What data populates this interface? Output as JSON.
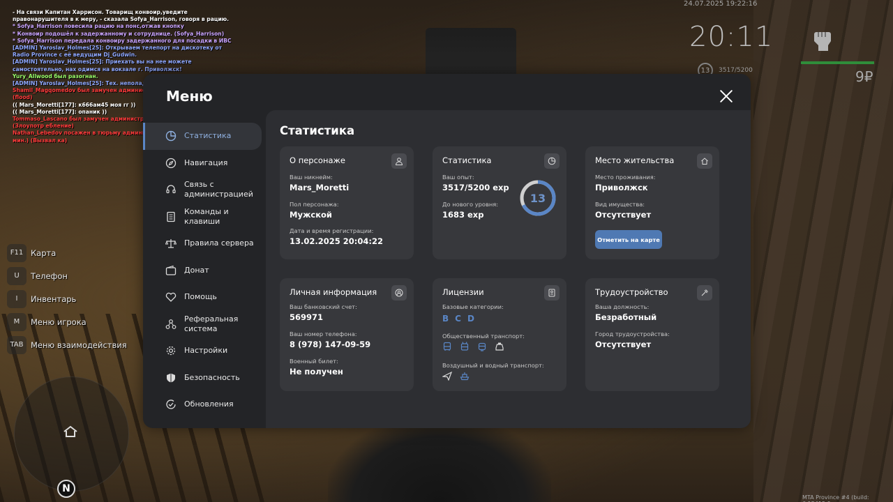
{
  "chat": [
    {
      "text": "- На связи Капитан Харрисон. Товарищ конвоир,уведите правонарушителя в к меру, - сказала Sofya_Harrison, говоря в рацию.",
      "color": "#ffffff"
    },
    {
      "text": "* Sofya_Harrison повесила рацию на понс,отжав кнопку",
      "color": "#c9a4ff"
    },
    {
      "text": "* Конвоир подошёл к задержанному и сотруднице. (Sofya_Harrison)",
      "color": "#c9a4ff"
    },
    {
      "text": "* Sofya_Harrison передала конвоиру задержанного для посадки в ИВС",
      "color": "#c9a4ff"
    },
    {
      "text": "[ADMIN] Yaroslav_Holmes[25]: Открываем телепорт на дискотеку от Radio Province с её ведущим Dj_Gudwin.",
      "color": "#8fa8ff"
    },
    {
      "text": "[ADMIN] Yaroslav_Holmes[25]: Приехать вы на нее можете самостоятельно, нах одимся на вокзале г. Приволжск!",
      "color": "#8fa8ff"
    },
    {
      "text": "Yury_Allwood был разогнан.",
      "color": "#9bff6a"
    },
    {
      "text": "[ADMIN] Yaroslav_Holmes[25]: Тех. неполадки.",
      "color": "#8fa8ff"
    },
    {
      "text": "Shamil_Magqomedov был замучен администратором Saburo_Ito (1 час.) (flood)",
      "color": "#ff3b3b"
    },
    {
      "text": "(( Mars_Moretti[177]: к666ам45 моя гг ))",
      "color": "#ffffff"
    },
    {
      "text": "(( Mars_Moretti[177]: опаник ))",
      "color": "#ffffff"
    },
    {
      "text": "Tommaso_Lascano был замучен администратором Saburo_Ito (1 час.) (Злоупотр ебление)",
      "color": "#ff3b3b"
    },
    {
      "text": "Nathan_Lebedov посажен в тюрьму администратором Saburo_Ito (30 мин.) (Вызвал ка)",
      "color": "#ff3b3b"
    }
  ],
  "hud": {
    "datetime": "24.07.2025 19:22:16",
    "clock": "20:11",
    "level": "13",
    "exp": "3517/5200",
    "money": "9₽",
    "health_fraction": 1.0
  },
  "hotkeys": [
    {
      "key": "F11",
      "label": "Карта"
    },
    {
      "key": "U",
      "label": "Телефон"
    },
    {
      "key": "I",
      "label": "Инвентарь"
    },
    {
      "key": "M",
      "label": "Меню игрока"
    },
    {
      "key": "TAB",
      "label": "Меню взаимодействия"
    }
  ],
  "minimap": {
    "north": "N"
  },
  "build_info": "MTA Province #4 (build: 6.12415.9",
  "menu": {
    "title": "Меню",
    "sidebar": [
      {
        "label": "Статистика",
        "icon": "pie-chart-icon",
        "active": true
      },
      {
        "label": "Навигация",
        "icon": "compass-icon"
      },
      {
        "label": "Связь с администрацией",
        "icon": "headset-icon"
      },
      {
        "label": "Команды и клавиши",
        "icon": "document-icon"
      },
      {
        "label": "Правила сервера",
        "icon": "scales-icon"
      },
      {
        "label": "Донат",
        "icon": "wallet-icon"
      },
      {
        "label": "Помощь",
        "icon": "handshake-heart-icon"
      },
      {
        "label": "Реферальная система",
        "icon": "network-icon"
      },
      {
        "label": "Настройки",
        "icon": "gear-icon"
      },
      {
        "label": "Безопасность",
        "icon": "shield-icon"
      },
      {
        "label": "Обновления",
        "icon": "refresh-check-icon"
      }
    ],
    "content_title": "Статистика",
    "cards": {
      "persona": {
        "title": "О персонаже",
        "nick_label": "Ваш никнейм:",
        "nick": "Mars_Moretti",
        "gender_label": "Пол персонажа:",
        "gender": "Мужской",
        "reg_label": "Дата и время регистрации:",
        "reg": "13.02.2025 20:04:22"
      },
      "stats": {
        "title": "Статистика",
        "exp_label": "Ваш опыт:",
        "exp": "3517/5200 exp",
        "next_label": "До нового уровня:",
        "next": "1683 exp",
        "level": "13",
        "progress": 0.676
      },
      "residence": {
        "title": "Место жительства",
        "place_label": "Место проживания:",
        "place": "Приволжск",
        "property_label": "Вид имущества:",
        "property": "Отсутствует",
        "button": "Отметить на карте"
      },
      "personal": {
        "title": "Личная информация",
        "bank_label": "Ваш банковский счет:",
        "bank": "569971",
        "phone_label": "Ваш номер телефона:",
        "phone": "8 (978) 147-09-59",
        "military_label": "Военный билет:",
        "military": "Не получен"
      },
      "licenses": {
        "title": "Лицензии",
        "base_label": "Базовые категории:",
        "categories": [
          "B",
          "C",
          "D"
        ],
        "public_label": "Общественный транспорт:",
        "air_label": "Воздушный и водный транспорт:"
      },
      "employment": {
        "title": "Трудоустройство",
        "position_label": "Ваша должность:",
        "position": "Безработный",
        "city_label": "Город трудоустройства:",
        "city": "Отсутствует"
      }
    }
  },
  "colors": {
    "accent": "#5a86c6",
    "panel": "#232427",
    "card": "#37383c",
    "health": "#2f8d3a"
  }
}
